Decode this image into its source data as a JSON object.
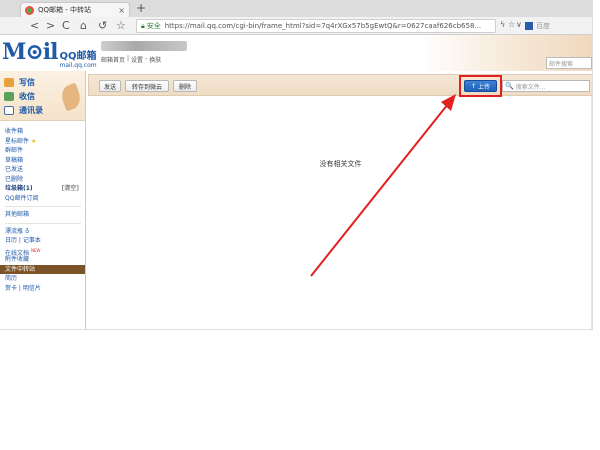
{
  "browser": {
    "tab_title": "QQ邮箱 - 中转站",
    "tab_close": "×",
    "new_tab": "+",
    "nav": {
      "back": "<",
      "forward": ">",
      "reload": "C",
      "home": "⌂",
      "undo": "↺",
      "star": "☆"
    },
    "secure_label": "安全",
    "url": "https://mail.qq.com/cgi-bin/frame_html?sid=7q4rXGx57b5gEwtQ&r=0627caaf626cb658...",
    "ext_icons": [
      "ϟ",
      "☆",
      "∨"
    ],
    "search_engine": "百度"
  },
  "header": {
    "logo_big": "M⊙il",
    "logo_cn": "QQ邮箱",
    "logo_domain": "mail.qq.com",
    "links": [
      "邮箱首页",
      "|",
      "设置",
      "-",
      "换肤"
    ],
    "search_placeholder": "邮件搜索"
  },
  "sidebar": {
    "quick": [
      {
        "label": "写信"
      },
      {
        "label": "收信"
      },
      {
        "label": "通讯录"
      }
    ],
    "folders": [
      {
        "label": "收件箱"
      },
      {
        "label": "星标邮件",
        "star": "★"
      },
      {
        "label": "群邮件"
      },
      {
        "label": "草稿箱"
      },
      {
        "label": "已发送"
      },
      {
        "label": "已删除"
      },
      {
        "label": "垃圾箱(1)",
        "sub": "[清空]"
      },
      {
        "label": "QQ邮件订阅"
      }
    ],
    "other_label": "其他邮箱",
    "tools": [
      {
        "label": "漂流瓶",
        "mark": "♁"
      },
      {
        "label": "日历 | 记事本"
      },
      {
        "label": "在线文档",
        "new": "NEW"
      },
      {
        "label": "附件收藏"
      },
      {
        "label": "文件中转站"
      },
      {
        "label": "简历"
      },
      {
        "label": "贺卡 | 明信片"
      }
    ]
  },
  "toolbar": {
    "buttons": [
      "发送",
      "转存到微云",
      "删除"
    ],
    "upload_arrow": "↑",
    "upload_label": "上传",
    "search_icon": "🔍",
    "search_placeholder": "搜索文件..."
  },
  "main": {
    "empty_text": "没有相关文件"
  },
  "colors": {
    "accent_blue": "#1e5aa8",
    "annotation_red": "#e32020",
    "active_folder_bg": "#7a5428"
  }
}
